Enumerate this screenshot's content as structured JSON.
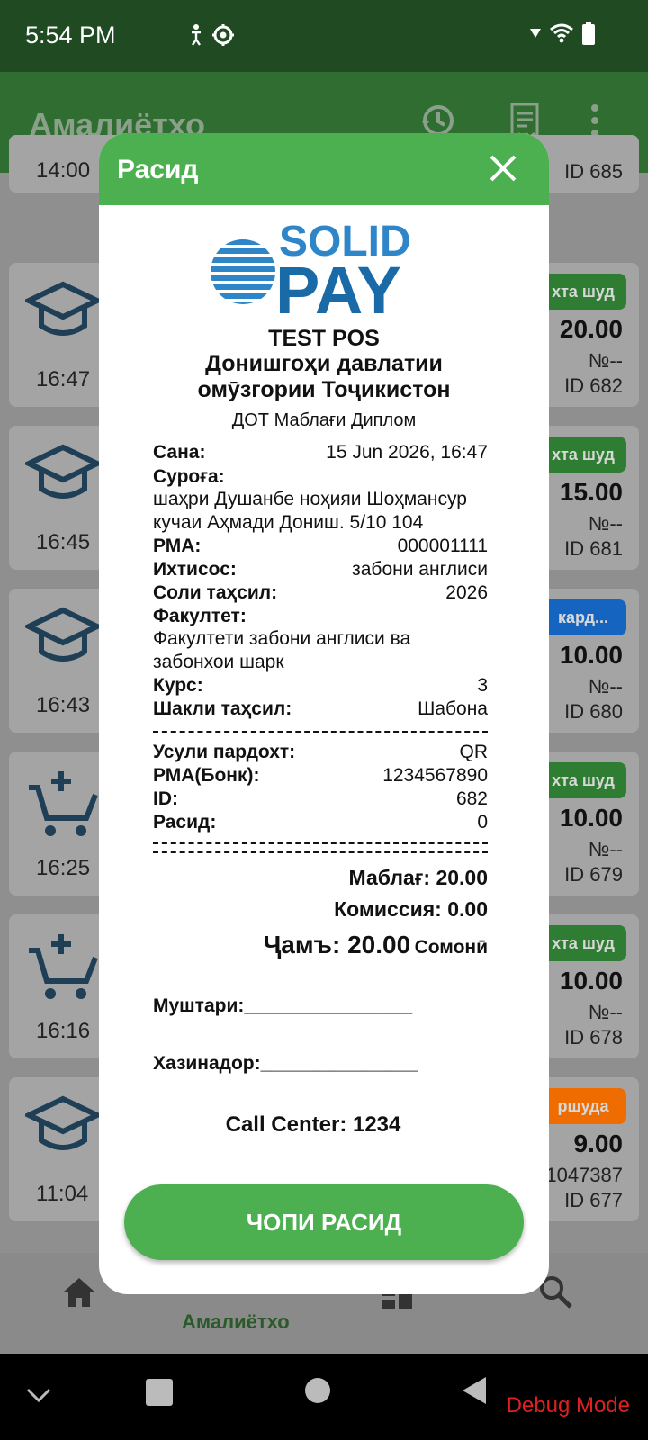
{
  "status_bar": {
    "time": "5:54 PM"
  },
  "app_bar": {
    "title": "Амалиётхо"
  },
  "partial_top": {
    "time": "14:00",
    "id": "ID 685"
  },
  "transactions": [
    {
      "time": "16:47",
      "badge": "хта шуд",
      "badge_color": "#2e7d32",
      "amount": "20.00",
      "number": "№--",
      "id": "ID 682",
      "icon": "graduation-cap-icon"
    },
    {
      "time": "16:45",
      "badge": "хта шуд",
      "badge_color": "#2e7d32",
      "amount": "15.00",
      "number": "№--",
      "id": "ID 681",
      "icon": "graduation-cap-icon"
    },
    {
      "time": "16:43",
      "badge": "кард...",
      "badge_color": "#1565c0",
      "amount": "10.00",
      "number": "№--",
      "id": "ID 680",
      "icon": "graduation-cap-icon"
    },
    {
      "time": "16:25",
      "badge": "хта шуд",
      "badge_color": "#2e7d32",
      "amount": "10.00",
      "number": "№--",
      "id": "ID 679",
      "icon": "cart-plus-icon"
    },
    {
      "time": "16:16",
      "badge": "хта шуд",
      "badge_color": "#2e7d32",
      "amount": "10.00",
      "number": "№--",
      "id": "ID 678",
      "icon": "cart-plus-icon"
    },
    {
      "time": "11:04",
      "badge": "ршуда",
      "badge_color": "#ef6c00",
      "amount": "9.00",
      "number": "№1047387",
      "id": "ID 677",
      "icon": "graduation-cap-icon"
    }
  ],
  "bottom_nav": {
    "active_label": "Амалиётхо"
  },
  "system_nav": {
    "debug": "Debug Mode"
  },
  "receipt": {
    "title": "Расид",
    "logo_line1": "SOLID",
    "logo_line2": "PAY",
    "pos": "TEST POS",
    "org_line1": "Донишгоҳи давлатии",
    "org_line2": "омӯзгории Тоҷикистон",
    "service": "ДОТ Маблағи Диплом",
    "date_label": "Сана:",
    "date_value": "15 Jun 2026, 16:47",
    "address_label": "Суроға:",
    "address_line1": "шаҳри Душанбе ноҳияи Шоҳмансур",
    "address_line2": "кучаи Аҳмади Дониш. 5/10 104",
    "rma_label": "РМА:",
    "rma_value": "000001111",
    "spec_label": "Ихтисос:",
    "spec_value": "забони англиси",
    "year_label": "Соли таҳсил:",
    "year_value": "2026",
    "faculty_label": "Факултет:",
    "faculty_line1": "Факултети забони англиси ва",
    "faculty_line2": "забонхои шарк",
    "course_label": "Курс:",
    "course_value": "3",
    "form_label": "Шакли таҳсил:",
    "form_value": "Шабона",
    "method_label": "Усули пардохт:",
    "method_value": "QR",
    "bank_label": "РМА(Бонк):",
    "bank_value": "1234567890",
    "id_label": "ID:",
    "id_value": "682",
    "receipt_label": "Расид:",
    "receipt_value": "0",
    "amount": "Маблағ: 20.00",
    "commission": "Комиссия: 0.00",
    "total": "Ҷамъ: 20.00",
    "currency": "Сомонӣ",
    "customer": "Муштари:________________",
    "cashier": "Хазинадор:_______________",
    "call_center": "Call Center: 1234",
    "print_button": "ЧОПИ РАСИД"
  }
}
